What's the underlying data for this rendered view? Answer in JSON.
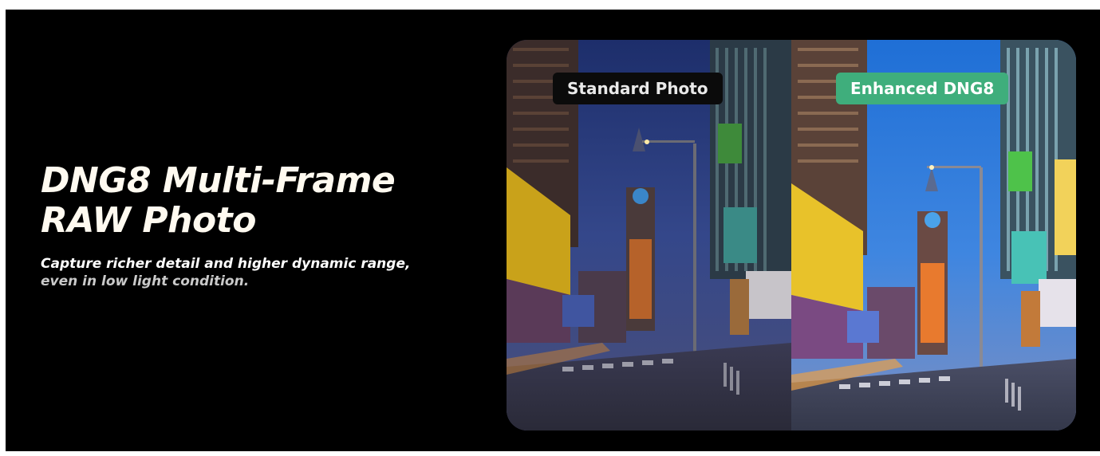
{
  "headline": {
    "line1": "DNG8 Multi-Frame",
    "line2": "RAW Photo"
  },
  "subtext": {
    "line1": "Capture richer detail and higher dynamic range,",
    "line2": "even in low light condition."
  },
  "comparison": {
    "left_label": "Standard Photo",
    "right_label": "Enhanced DNG8"
  },
  "colors": {
    "background": "#000000",
    "headline": "#fffaf0",
    "standard_badge": "#0b0b0b",
    "enhanced_badge": "#3fae7c"
  }
}
